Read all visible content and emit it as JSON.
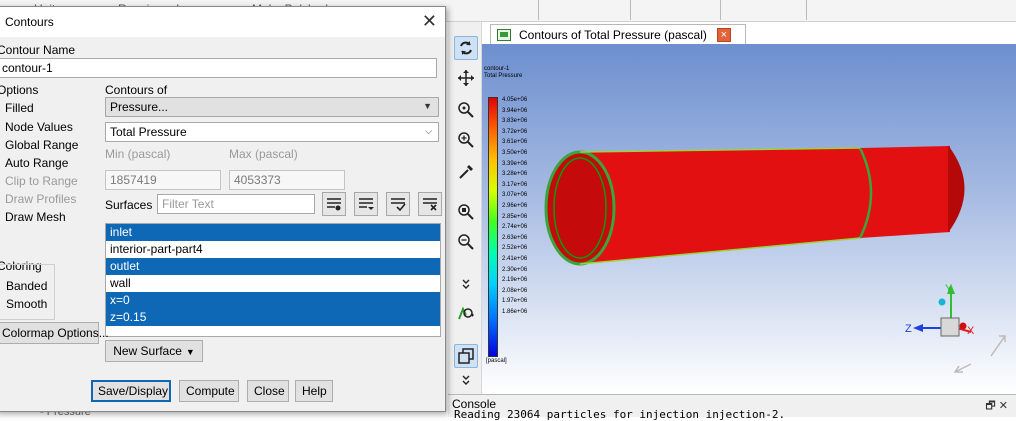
{
  "menubar": {
    "items": [
      "Units",
      "Repair",
      "Improve",
      "Make Polyhedra"
    ]
  },
  "graphics": {
    "tab_label": "Contours of Total Pressure (pascal)",
    "tab_close": "×",
    "colorbar_title_1": "contour-1",
    "colorbar_title_2": "Total Pressure",
    "colorbar_unit": "[pascal]",
    "colorbar_ticks": [
      "4.05e+06",
      "3.94e+06",
      "3.83e+06",
      "3.72e+06",
      "3.61e+06",
      "3.50e+06",
      "3.39e+06",
      "3.28e+06",
      "3.17e+06",
      "3.07e+06",
      "2.96e+06",
      "2.85e+06",
      "2.74e+06",
      "2.63e+06",
      "2.52e+06",
      "2.41e+06",
      "2.30e+06",
      "2.19e+06",
      "2.08e+06",
      "1.97e+06",
      "1.86e+06"
    ],
    "axis_x": "X",
    "axis_y": "Y",
    "axis_z": "Z"
  },
  "console": {
    "title": "Console",
    "line": "Reading 23064 particles for injection injection-2.",
    "controls": "🗗 ✕"
  },
  "outline": {
    "bottom_text": "- Pressure"
  },
  "dialog": {
    "title": "Contours",
    "close": "✕",
    "contour_name_label": "Contour Name",
    "contour_name_value": "contour-1",
    "options_label": "Options",
    "options": [
      "Filled",
      "Node Values",
      "Global Range",
      "Auto Range",
      "Clip to Range",
      "Draw Profiles",
      "Draw Mesh"
    ],
    "contours_of_label": "Contours of",
    "contours_of_value": "Pressure...",
    "contours_of_sub_value": "Total Pressure",
    "min_label": "Min (pascal)",
    "max_label": "Max (pascal)",
    "min_value": "1857419",
    "max_value": "4053373",
    "surfaces_label": "Surfaces",
    "filter_placeholder": "Filter Text",
    "surfaces": [
      {
        "name": "inlet",
        "selected": true
      },
      {
        "name": "interior-part-part4",
        "selected": false
      },
      {
        "name": "outlet",
        "selected": true
      },
      {
        "name": "wall",
        "selected": false
      },
      {
        "name": "x=0",
        "selected": true
      },
      {
        "name": "z=0.15",
        "selected": true
      }
    ],
    "coloring_label": "Coloring",
    "coloring_options": [
      "Banded",
      "Smooth"
    ],
    "colormap_button": "Colormap Options...",
    "new_surface_button": "New Surface",
    "buttons": {
      "save_display": "Save/Display",
      "compute": "Compute",
      "close": "Close",
      "help": "Help"
    }
  }
}
